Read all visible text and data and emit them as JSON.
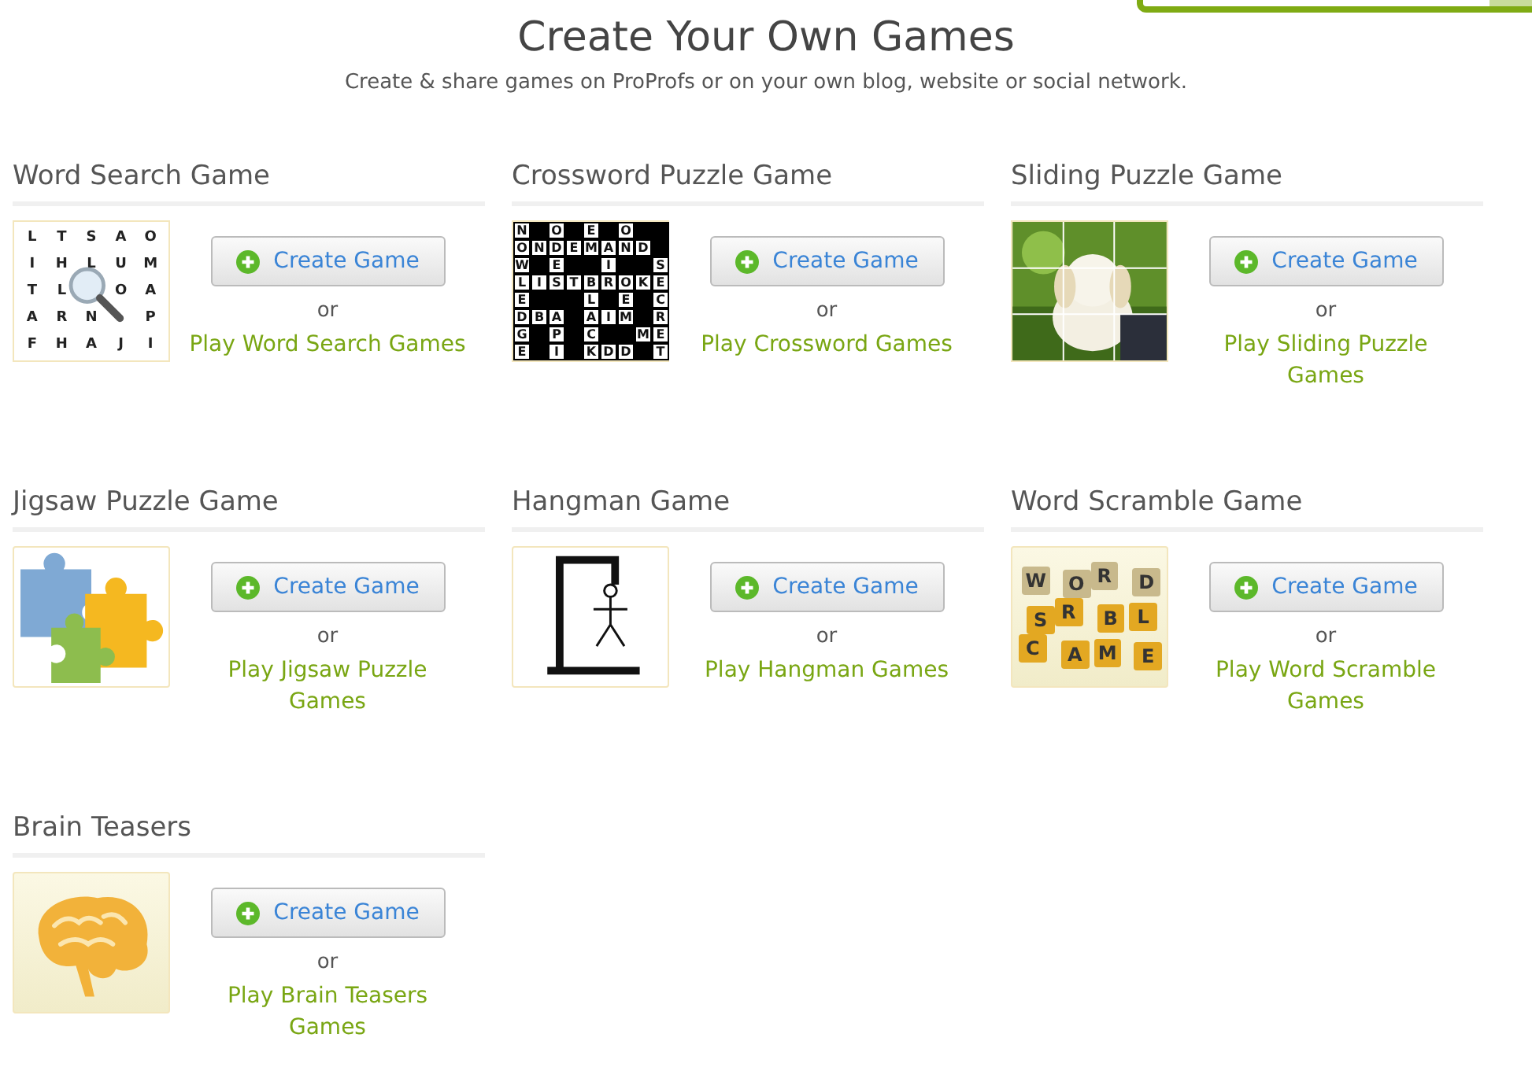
{
  "title": "Create Your Own Games",
  "subtitle": "Create & share games on ProProfs or on your own blog, website or social network.",
  "games": [
    {
      "name": "Word Search Game",
      "thumbnail": {
        "kind": "wordsearch",
        "rows": [
          [
            "L",
            "T",
            "S",
            "A",
            "O"
          ],
          [
            "I",
            "H",
            "L",
            "U",
            "M"
          ],
          [
            "T",
            "L",
            null,
            "O",
            "A"
          ],
          [
            "A",
            "R",
            "N",
            null,
            "P"
          ],
          [
            "F",
            "H",
            "A",
            "J",
            "I"
          ]
        ]
      },
      "button": "Create Game",
      "or": "or",
      "link": "Play Word Search Games"
    },
    {
      "name": "Crossword Puzzle Game",
      "thumbnail": {
        "kind": "crossword",
        "rows": [
          [
            "N",
            null,
            "O",
            null,
            "E",
            null,
            "O",
            null,
            null
          ],
          [
            "O",
            "N",
            "D",
            "E",
            "M",
            "A",
            "N",
            "D",
            null
          ],
          [
            "W",
            null,
            "E",
            null,
            null,
            "I",
            null,
            null,
            "S"
          ],
          [
            "L",
            "I",
            "S",
            "T",
            "B",
            "R",
            "O",
            "K",
            "E"
          ],
          [
            "E",
            null,
            null,
            null,
            "L",
            null,
            "E",
            null,
            "C"
          ],
          [
            "D",
            "B",
            "A",
            null,
            "A",
            "I",
            "M",
            null,
            "R"
          ],
          [
            "G",
            null,
            "P",
            null,
            "C",
            null,
            null,
            "M",
            "E"
          ],
          [
            "E",
            null,
            "I",
            null,
            "K",
            "D",
            "D",
            null,
            "T"
          ]
        ]
      },
      "button": "Create Game",
      "or": "or",
      "link": "Play Crossword Games"
    },
    {
      "name": "Sliding Puzzle Game",
      "button": "Create Game",
      "or": "or",
      "link": "Play Sliding Puzzle Games"
    },
    {
      "name": "Jigsaw Puzzle Game",
      "thumbnail": {
        "kind": "jigsaw"
      },
      "button": "Create Game",
      "or": "or",
      "link": "Play Jigsaw Puzzle Games"
    },
    {
      "name": "Hangman Game",
      "thumbnail": {
        "kind": "hangman"
      },
      "button": "Create Game",
      "or": "or",
      "link": "Play Hangman Games"
    },
    {
      "name": "Word Scramble Game",
      "thumbnail": {
        "kind": "scramble",
        "rows": [
          {
            "tiles": [
              "W",
              "O",
              "R",
              "D"
            ],
            "color": "#c8b98c"
          },
          {
            "tiles": [
              "S",
              "R",
              "B",
              "L"
            ],
            "color": "#e3a822"
          },
          {
            "tiles": [
              "C",
              "A",
              "M",
              "E"
            ],
            "color": "#e3a822"
          }
        ]
      },
      "button": "Create Game",
      "or": "or",
      "link": "Play Word Scramble Games"
    },
    {
      "name": "Brain Teasers",
      "thumbnail": {
        "kind": "brain"
      },
      "button": "Create Game",
      "or": "or",
      "link": "Play Brain Teasers Games"
    }
  ]
}
